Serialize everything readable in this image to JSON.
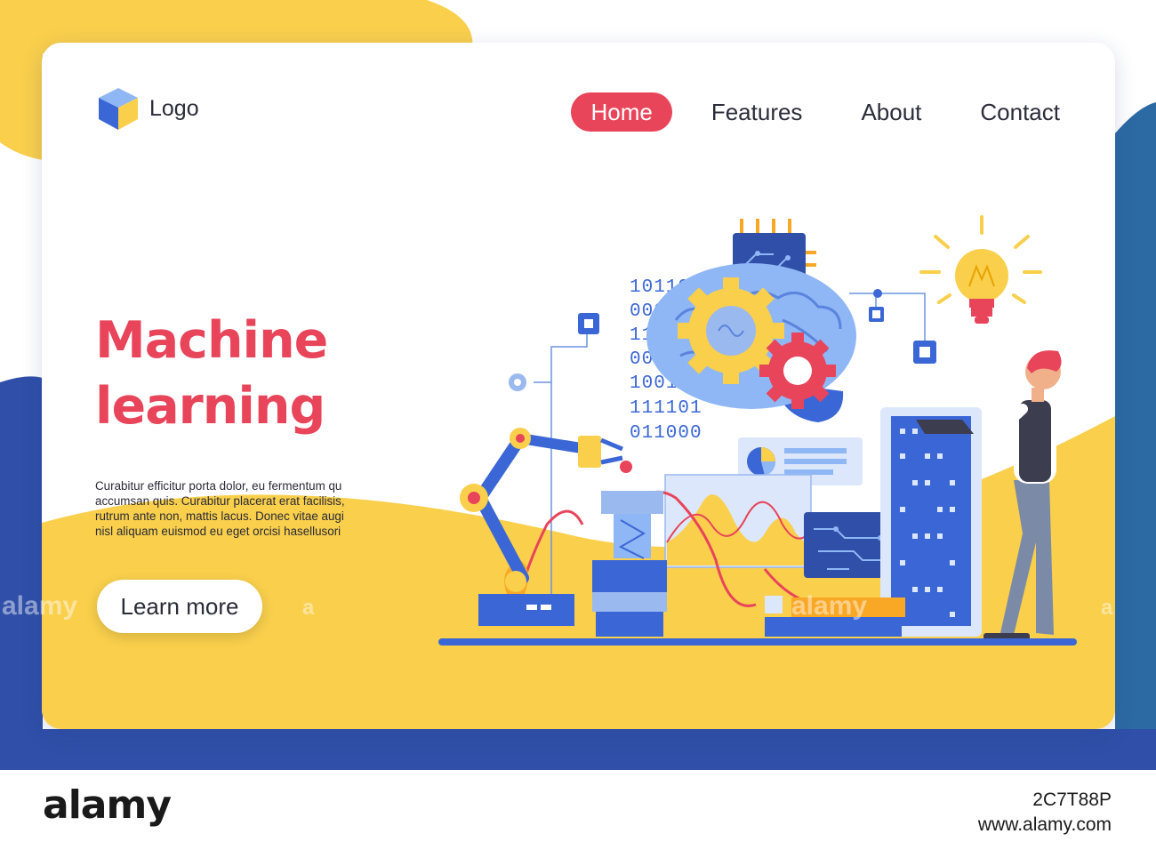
{
  "logo": {
    "text": "Logo",
    "icon": "cube-icon"
  },
  "nav": {
    "items": [
      {
        "label": "Home",
        "active": true
      },
      {
        "label": "Features",
        "active": false
      },
      {
        "label": "About",
        "active": false
      },
      {
        "label": "Contact",
        "active": false
      }
    ]
  },
  "hero": {
    "title": "Machine\nlearning",
    "body": "Curabitur efficitur porta dolor, eu fermentum qu accumsan quis. Curabitur placerat erat facilisis, rutrum ante non, mattis lacus. Donec vitae augi nisl aliquam euismod eu eget orcisi hasellusori",
    "cta_label": "Learn more"
  },
  "illustration": {
    "binary_rows": [
      "10110",
      "000",
      "11",
      "00",
      "10010",
      "111101",
      "011000"
    ]
  },
  "stock": {
    "brand": "alamy",
    "image_id": "2C7T88P",
    "site": "www.alamy.com",
    "watermark": "alamy",
    "watermark_letter": "a"
  },
  "colors": {
    "accent": "#e8445a",
    "yellow": "#f9cf4c",
    "blue": "#2f4fa8",
    "teal": "#2c6aa4"
  }
}
